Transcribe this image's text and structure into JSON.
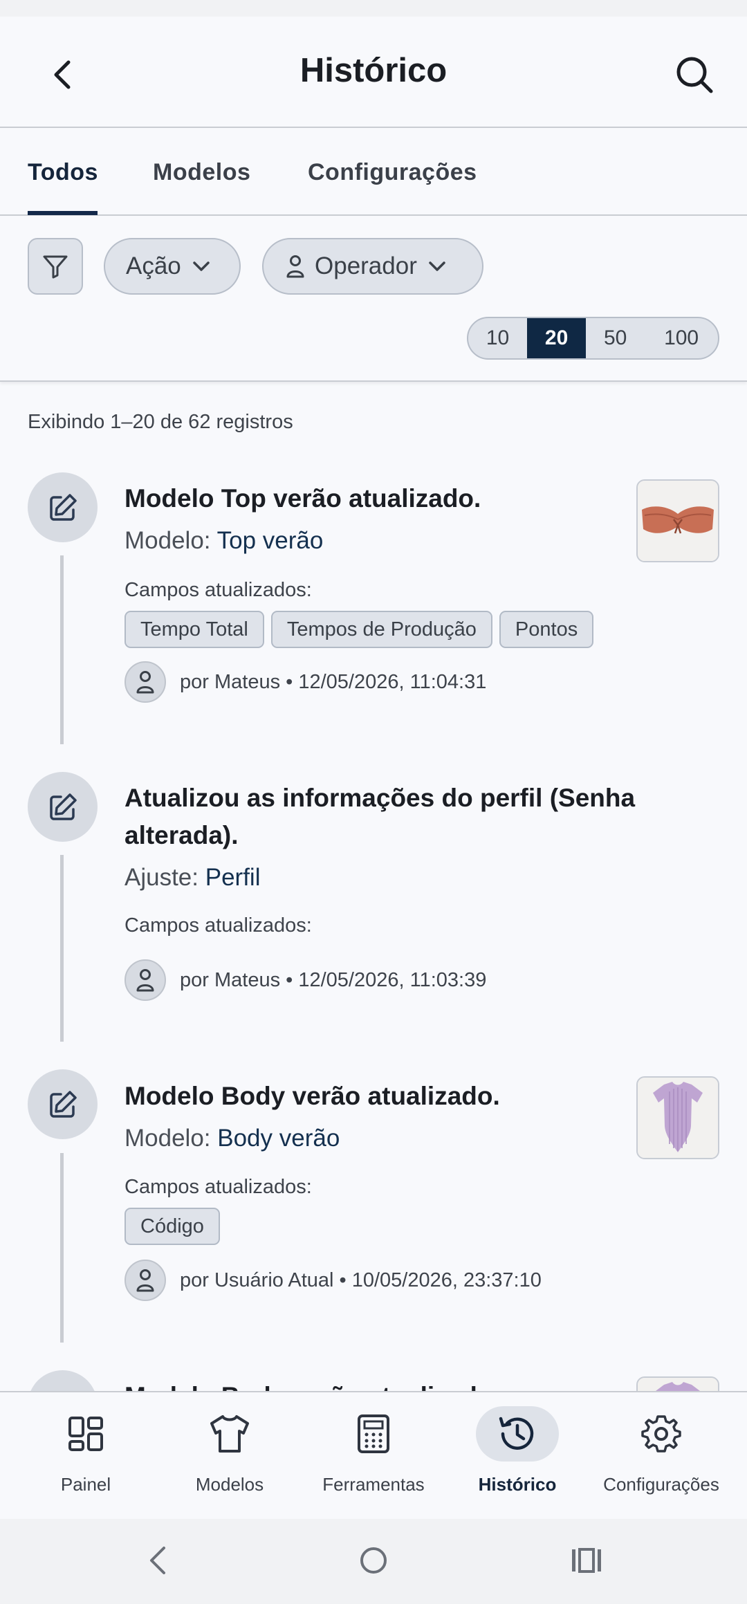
{
  "header": {
    "title": "Histórico"
  },
  "tabs": [
    {
      "label": "Todos",
      "active": true
    },
    {
      "label": "Modelos",
      "active": false
    },
    {
      "label": "Configurações",
      "active": false
    }
  ],
  "filters": {
    "action_label": "Ação",
    "operator_label": "Operador",
    "page_sizes": [
      "10",
      "20",
      "50",
      "100"
    ],
    "selected_page_size": "20"
  },
  "summary": "Exibindo 1–20 de 62 registros",
  "entries": [
    {
      "title": "Modelo Top verão atualizado.",
      "sub_prefix": "Modelo: ",
      "sub_link": "Top verão",
      "fields_label": "Campos atualizados:",
      "tags": [
        "Tempo Total",
        "Tempos de Produção",
        "Pontos"
      ],
      "meta": "por Mateus • 12/05/2026, 11:04:31",
      "thumbnail": "bikini-top"
    },
    {
      "title": "Atualizou as informações do perfil (Senha alterada).",
      "sub_prefix": "Ajuste: ",
      "sub_link": "Perfil",
      "fields_label": "Campos atualizados:",
      "tags": [],
      "meta": "por Mateus • 12/05/2026, 11:03:39"
    },
    {
      "title": "Modelo Body verão atualizado.",
      "sub_prefix": "Modelo: ",
      "sub_link": "Body verão",
      "fields_label": "Campos atualizados:",
      "tags": [
        "Código"
      ],
      "meta": "por Usuário Atual • 10/05/2026, 23:37:10",
      "thumbnail": "bodysuit"
    },
    {
      "title": "Modelo Body verão atualizado.",
      "thumbnail": "bodysuit"
    }
  ],
  "bottom_nav": [
    {
      "label": "Painel",
      "icon": "dashboard-icon",
      "active": false
    },
    {
      "label": "Modelos",
      "icon": "shirt-icon",
      "active": false
    },
    {
      "label": "Ferramentas",
      "icon": "calculator-icon",
      "active": false
    },
    {
      "label": "Histórico",
      "icon": "history-icon",
      "active": true
    },
    {
      "label": "Configurações",
      "icon": "gear-icon",
      "active": false
    }
  ],
  "colors": {
    "primary": "#0f2844",
    "chip_bg": "#dfe3ea",
    "background": "#f8f9fc"
  }
}
